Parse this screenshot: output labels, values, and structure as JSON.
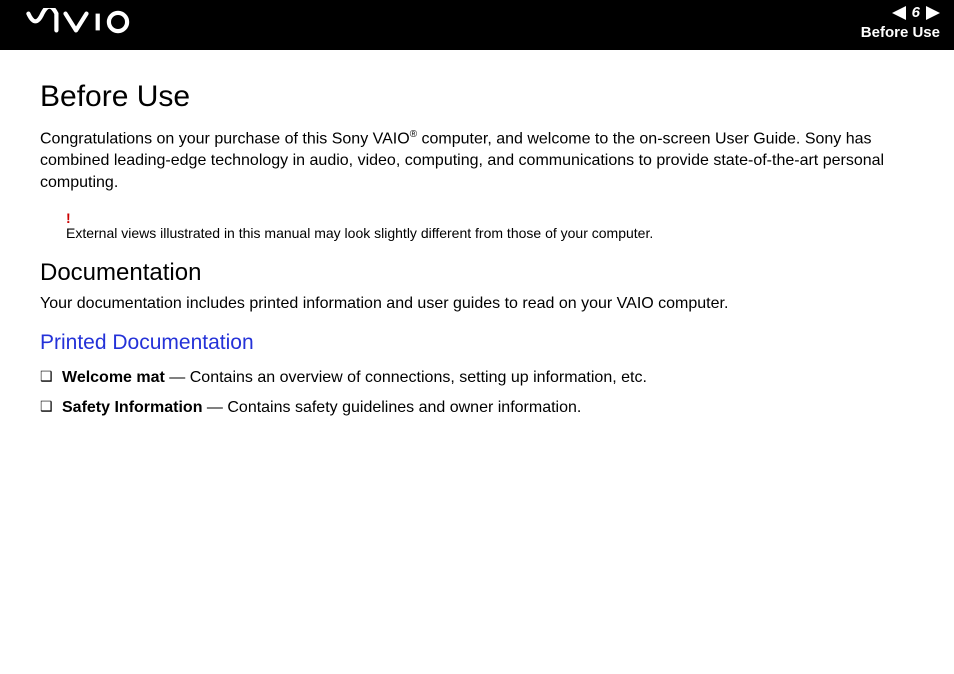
{
  "header": {
    "page_number": "6",
    "section_label": "Before Use"
  },
  "content": {
    "title": "Before Use",
    "intro_prefix": "Congratulations on your purchase of this Sony VAIO",
    "intro_sup": "®",
    "intro_suffix": " computer, and welcome to the on-screen User Guide. Sony has combined leading-edge technology in audio, video, computing, and communications to provide state-of-the-art personal computing.",
    "note_bang": "!",
    "note_text": "External views illustrated in this manual may look slightly different from those of your computer.",
    "h2": "Documentation",
    "doc_intro": "Your documentation includes printed information and user guides to read on your VAIO computer.",
    "h3": "Printed Documentation",
    "items": [
      {
        "name": "Welcome mat",
        "desc": " — Contains an overview of connections, setting up information, etc."
      },
      {
        "name": "Safety Information",
        "desc": " — Contains safety guidelines and owner information."
      }
    ]
  }
}
